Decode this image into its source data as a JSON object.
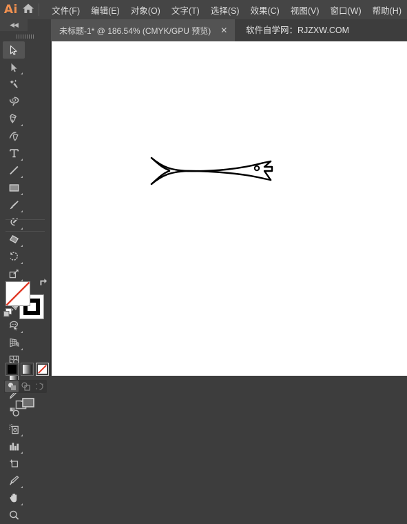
{
  "app": {
    "logo_text": "Ai",
    "home_icon": "home-icon"
  },
  "menubar": {
    "items": [
      {
        "label": "文件(F)",
        "name": "menu-file"
      },
      {
        "label": "编辑(E)",
        "name": "menu-edit"
      },
      {
        "label": "对象(O)",
        "name": "menu-object"
      },
      {
        "label": "文字(T)",
        "name": "menu-type"
      },
      {
        "label": "选择(S)",
        "name": "menu-select"
      },
      {
        "label": "效果(C)",
        "name": "menu-effect"
      },
      {
        "label": "视图(V)",
        "name": "menu-view"
      },
      {
        "label": "窗口(W)",
        "name": "menu-window"
      },
      {
        "label": "帮助(H)",
        "name": "menu-help"
      }
    ]
  },
  "tabbar": {
    "collapse_label": "◀◀",
    "document_tab": {
      "title": "未标题-1* @ 186.54% (CMYK/GPU 预览)",
      "close_label": "✕",
      "document_name": "未标题-1",
      "modified": "*",
      "zoom": "186.54%",
      "color_mode": "CMYK",
      "render_mode": "GPU 预览"
    },
    "watermark": "软件自学网：RJZXW.COM"
  },
  "toolbar": {
    "tools": [
      {
        "name": "selection-tool",
        "label": "选择工具",
        "icon": "arrow-solid-icon",
        "active": true,
        "corner": false
      },
      {
        "name": "direct-selection-tool",
        "label": "直接选择工具",
        "icon": "arrow-white-icon",
        "active": false,
        "corner": true
      },
      {
        "name": "magic-wand-tool",
        "label": "魔棒工具",
        "icon": "magic-wand-icon",
        "active": false,
        "corner": false
      },
      {
        "name": "lasso-tool",
        "label": "套索工具",
        "icon": "lasso-icon",
        "active": false,
        "corner": false
      },
      {
        "name": "pen-tool",
        "label": "钢笔工具",
        "icon": "pen-icon",
        "active": false,
        "corner": true
      },
      {
        "name": "curvature-tool",
        "label": "曲率工具",
        "icon": "curvature-icon",
        "active": false,
        "corner": false
      },
      {
        "name": "type-tool",
        "label": "文字工具",
        "icon": "type-t-icon",
        "active": false,
        "corner": true
      },
      {
        "name": "line-segment-tool",
        "label": "直线段工具",
        "icon": "line-segment-icon",
        "active": false,
        "corner": true
      },
      {
        "name": "rectangle-tool",
        "label": "矩形工具",
        "icon": "rectangle-icon",
        "active": false,
        "corner": true
      },
      {
        "name": "paintbrush-tool",
        "label": "画笔工具",
        "icon": "paintbrush-icon",
        "active": false,
        "corner": true
      },
      {
        "name": "shaper-pencil-tool",
        "label": "Shaper 工具",
        "icon": "shaper-pencil-icon",
        "active": false,
        "corner": true
      },
      {
        "name": "eraser-tool",
        "label": "橡皮擦工具",
        "icon": "eraser-icon",
        "active": false,
        "corner": true
      },
      {
        "name": "rotate-tool",
        "label": "旋转工具",
        "icon": "rotate-icon",
        "active": false,
        "corner": true
      },
      {
        "name": "scale-tool",
        "label": "比例缩放工具",
        "icon": "scale-icon",
        "active": false,
        "corner": true
      },
      {
        "name": "width-tool",
        "label": "宽度工具",
        "icon": "width-warp-icon",
        "active": false,
        "corner": true
      },
      {
        "name": "free-transform-tool",
        "label": "自由变换工具",
        "icon": "free-transform-pin-icon",
        "active": false,
        "corner": false
      },
      {
        "name": "shape-builder-tool",
        "label": "形状生成器工具",
        "icon": "shape-builder-icon",
        "active": false,
        "corner": true
      },
      {
        "name": "perspective-grid-tool",
        "label": "透视网格工具",
        "icon": "perspective-grid-icon",
        "active": false,
        "corner": true
      },
      {
        "name": "mesh-tool",
        "label": "网格工具",
        "icon": "mesh-icon",
        "active": false,
        "corner": false
      },
      {
        "name": "gradient-tool",
        "label": "渐变工具",
        "icon": "gradient-icon",
        "active": false,
        "corner": false
      },
      {
        "name": "eyedropper-tool",
        "label": "吸管工具",
        "icon": "eyedropper-icon",
        "active": false,
        "corner": true
      },
      {
        "name": "blend-tool",
        "label": "混合工具",
        "icon": "blend-icon",
        "active": false,
        "corner": false
      },
      {
        "name": "symbol-sprayer-tool",
        "label": "符号喷枪工具",
        "icon": "symbol-sprayer-icon",
        "active": false,
        "corner": true
      },
      {
        "name": "column-graph-tool",
        "label": "柱形图工具",
        "icon": "column-graph-icon",
        "active": false,
        "corner": true
      },
      {
        "name": "artboard-tool",
        "label": "画板工具",
        "icon": "artboard-icon",
        "active": false,
        "corner": false
      },
      {
        "name": "slice-tool",
        "label": "切片工具",
        "icon": "slice-knife-icon",
        "active": false,
        "corner": true
      },
      {
        "name": "hand-tool",
        "label": "抓手工具",
        "icon": "hand-icon",
        "active": false,
        "corner": true
      },
      {
        "name": "zoom-tool",
        "label": "缩放工具",
        "icon": "magnifier-icon",
        "active": false,
        "corner": false
      }
    ],
    "fill_stroke": {
      "fill_label": "填色",
      "fill_value": "无",
      "stroke_label": "描边",
      "stroke_value": "黑色",
      "swap_label": "互换填色和描边",
      "default_label": "默认填色和描边"
    },
    "color_modes": [
      {
        "name": "color-button",
        "label": "颜色",
        "selected": false
      },
      {
        "name": "gradient-button",
        "label": "渐变",
        "selected": false
      },
      {
        "name": "none-button",
        "label": "无",
        "selected": true
      }
    ],
    "draw_modes": [
      {
        "name": "draw-normal-button",
        "label": "正常绘图",
        "selected": true
      },
      {
        "name": "draw-behind-button",
        "label": "背面绘图",
        "selected": false
      },
      {
        "name": "draw-inside-button",
        "label": "内部绘图",
        "selected": false
      }
    ],
    "screen_mode": {
      "name": "screen-mode-button",
      "label": "更改屏幕模式"
    }
  },
  "colors": {
    "menubar_bg": "#454545",
    "panel_bg": "#3d3d3d",
    "tab_active_bg": "#535353",
    "canvas_bg": "#ffffff",
    "accent_orange": "#f09050",
    "text_primary": "#dcdcdc",
    "artwork_stroke": "#000000"
  },
  "canvas": {
    "artwork_name": "fish-line-drawing",
    "artwork_label": "鱼形线稿",
    "stroke_color": "#000000",
    "fill_color": "none"
  }
}
